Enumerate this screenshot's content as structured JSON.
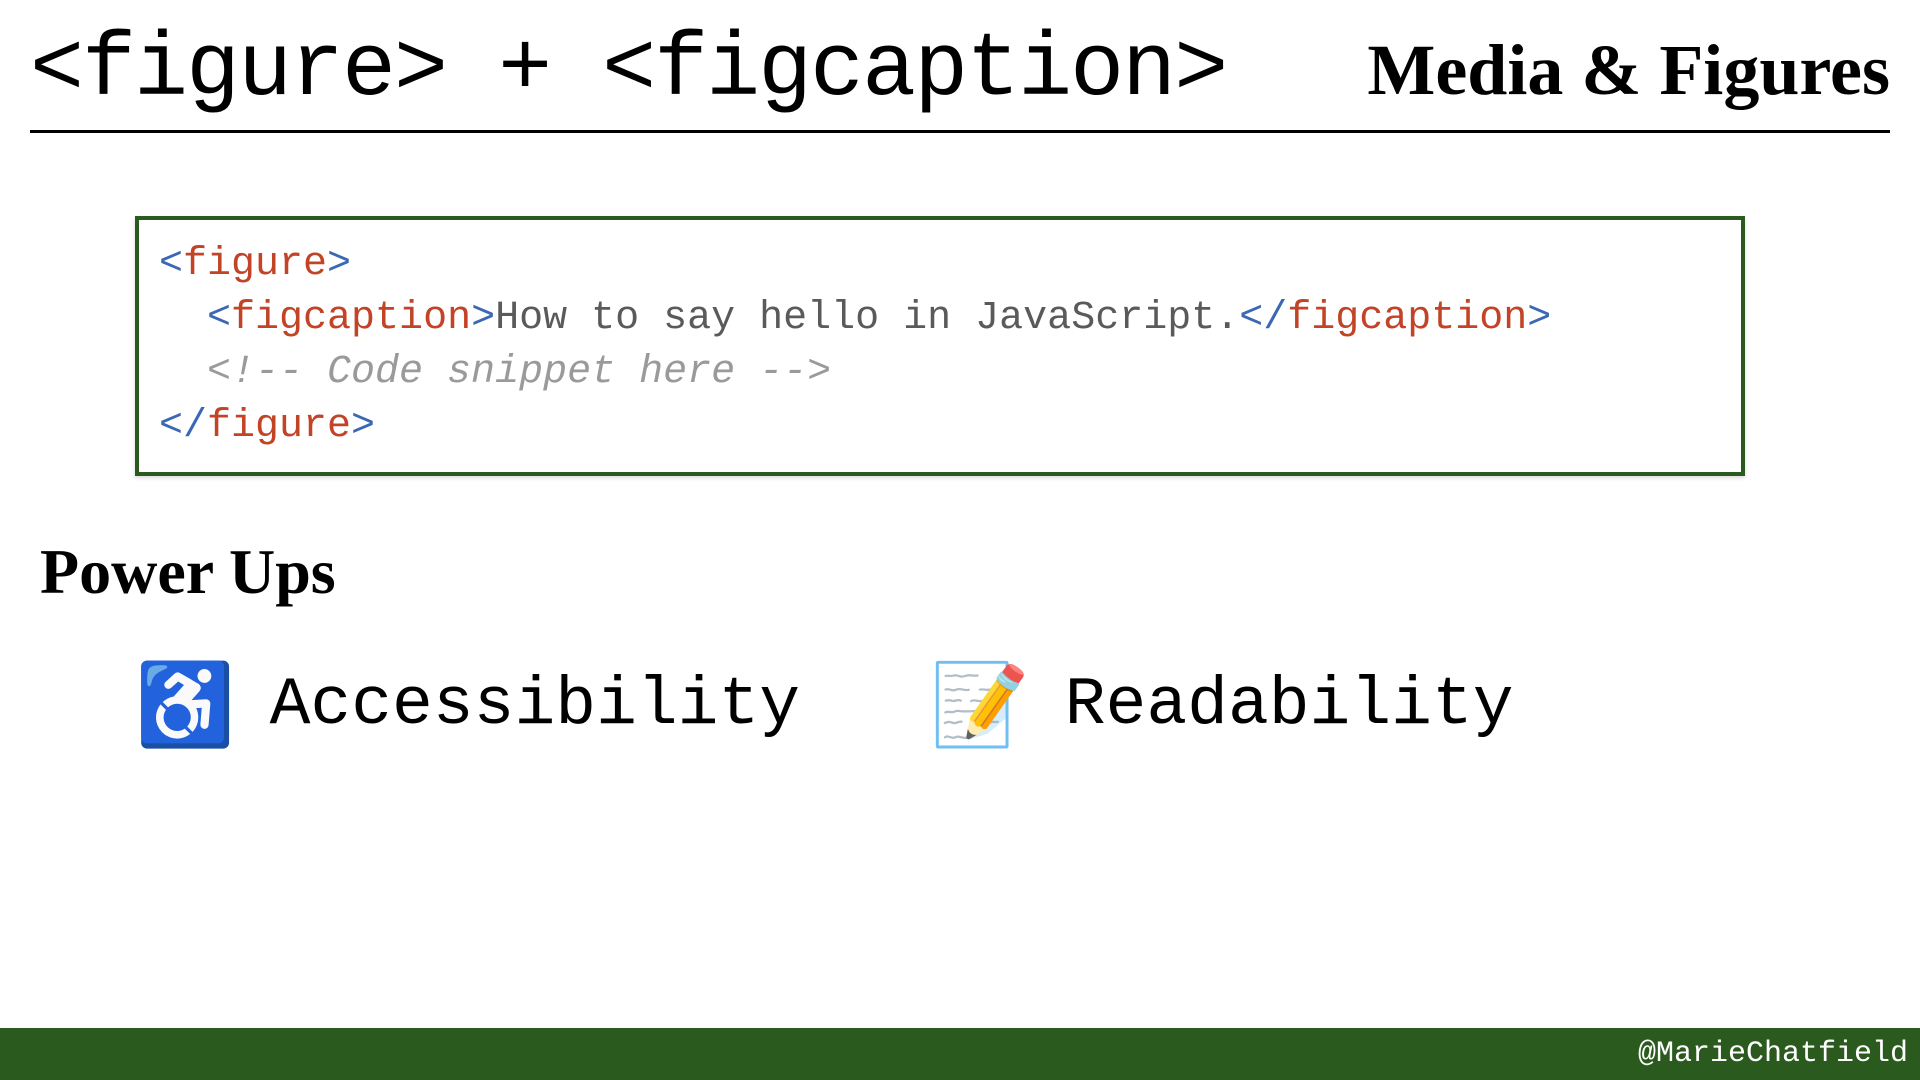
{
  "header": {
    "title": "<figure> + <figcaption>",
    "category": "Media & Figures"
  },
  "code": {
    "l1": {
      "open": "<",
      "tag": "figure",
      "close": ">"
    },
    "l2": {
      "indent": "  ",
      "open1": "<",
      "tag1": "figcaption",
      "close1": ">",
      "text": "How to say hello in JavaScript.",
      "open2": "</",
      "tag2": "figcaption",
      "close2": ">"
    },
    "l3": {
      "indent": "  ",
      "comment": "<!-- Code snippet here -->"
    },
    "l4": {
      "open": "</",
      "tag": "figure",
      "close": ">"
    }
  },
  "powerups": {
    "heading": "Power Ups",
    "items": [
      {
        "emoji": "♿",
        "label": "Accessibility"
      },
      {
        "emoji": "📝",
        "label": "Readability"
      }
    ]
  },
  "footer": {
    "handle": "@MarieChatfield"
  }
}
